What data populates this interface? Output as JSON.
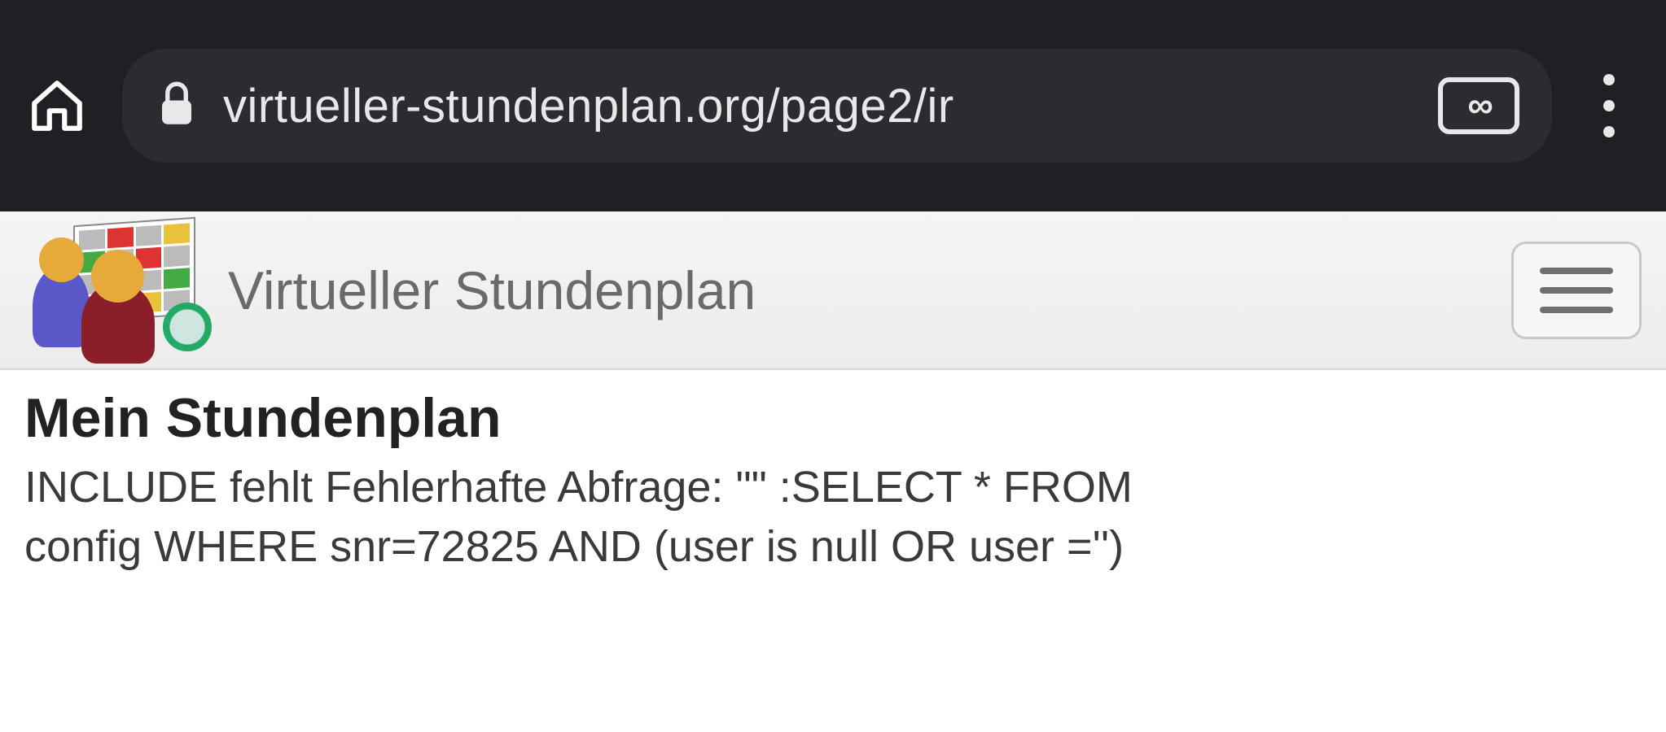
{
  "browser": {
    "url_display": "virtueller-stundenplan.org/page2/ir"
  },
  "site": {
    "title": "Virtueller Stundenplan"
  },
  "page": {
    "heading": "Mein Stundenplan",
    "error_message": "INCLUDE fehlt Fehlerhafte Abfrage: \"\" :SELECT * FROM config WHERE snr=72825 AND (user is null OR user ='')"
  }
}
